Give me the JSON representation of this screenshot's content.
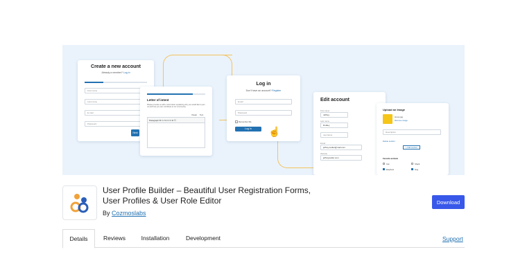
{
  "banner": {
    "create_account": {
      "title": "Create a new account",
      "subtitle_text": "Already a member?",
      "subtitle_link": "Log in",
      "fields": [
        "First name",
        "Last name",
        "E-mail",
        "Password"
      ],
      "next_label": "Next"
    },
    "letter": {
      "title": "Letter of intent",
      "body": "Please provide us with a short letter explaining why you would like to join us and how you can contribute to our community.",
      "toolbar": "Paragraph  B  I  U  S  ≡  ≡  ≡  ⧉  ⟲",
      "tabs": [
        "Visual",
        "Text"
      ]
    },
    "login": {
      "title": "Log in",
      "subtitle_text": "Don't have an account?",
      "subtitle_link": "Register",
      "fields": [
        "Email",
        "Password"
      ],
      "remember_label": "Remember Me",
      "button_label": "Log In"
    },
    "edit_account": {
      "title": "Edit account",
      "first_label": "First name",
      "first_value": "Jeffrey",
      "last_label": "Last name",
      "last_value": "Dudley",
      "username_label": "username",
      "email_label": "Email",
      "email_value": "jeffrey.sudler@mail.com",
      "website_label": "Website",
      "website_value": "jeffreysudler.com"
    },
    "upload": {
      "title": "Upload an Image",
      "file_name": "Hi-res.jpg",
      "remove_label": "Remove image",
      "description_placeholder": "Description",
      "delete_label": "Delete section",
      "add_label": "+ Add section",
      "favorites_title": "Favorite animals",
      "animals": [
        {
          "name": "Cat",
          "checked": false
        },
        {
          "name": "Elephant",
          "checked": true
        },
        {
          "name": "Shark",
          "checked": false
        },
        {
          "name": "Dog",
          "checked": true
        }
      ]
    }
  },
  "plugin": {
    "title": "User Profile Builder – Beautiful User Registration Forms, User Profiles & User Role Editor",
    "author_prefix": "By",
    "author_name": "Cozmoslabs",
    "download_label": "Download",
    "icon": "cozmoslabs-logo-icon"
  },
  "tabs": [
    "Details",
    "Reviews",
    "Installation",
    "Development"
  ],
  "active_tab": "Details",
  "support_label": "Support",
  "colors": {
    "accent": "#3858e9",
    "link": "#2271b1",
    "banner_bg": "#eaf3fc",
    "connector": "#f3c25e"
  }
}
